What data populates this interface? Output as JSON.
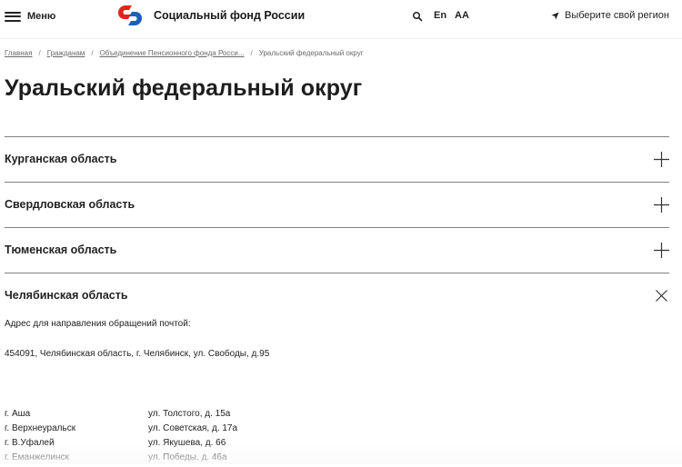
{
  "header": {
    "menu_label": "Меню",
    "logo_text": "Социальный фонд России",
    "lang_label": "En",
    "font_size_label": "AA",
    "region_label": "Выберите свой регион",
    "brand_colors": {
      "red": "#e2231a",
      "blue": "#1f5eb8"
    }
  },
  "breadcrumb": {
    "items": [
      "Главная",
      "Гражданам",
      "Объединение Пенсионного фонда Росси..."
    ],
    "current": "Уральский федеральный округ",
    "separator": "/"
  },
  "page": {
    "title": "Уральский федеральный округ"
  },
  "accordion": {
    "items": [
      {
        "title": "Курганская область",
        "expanded": false
      },
      {
        "title": "Свердловская область",
        "expanded": false
      },
      {
        "title": "Тюменская область",
        "expanded": false
      },
      {
        "title": "Челябинская область",
        "expanded": true
      }
    ],
    "expanded_content": {
      "address_label": "Адрес для направления обращений почтой:",
      "address_value": "454091, Челябинская область, г. Челябинск, ул. Свободы, д.95",
      "offices": [
        {
          "city": "г. Аша",
          "street": "ул. Толстого, д. 15а"
        },
        {
          "city": "г. Верхнеуральск",
          "street": "ул. Советская, д. 17а"
        },
        {
          "city": "г. В.Уфалей",
          "street": "ул. Якушева, д. 66"
        },
        {
          "city": "г. Еманжелинск",
          "street": "ул. Победы, д. 46а"
        }
      ]
    }
  }
}
